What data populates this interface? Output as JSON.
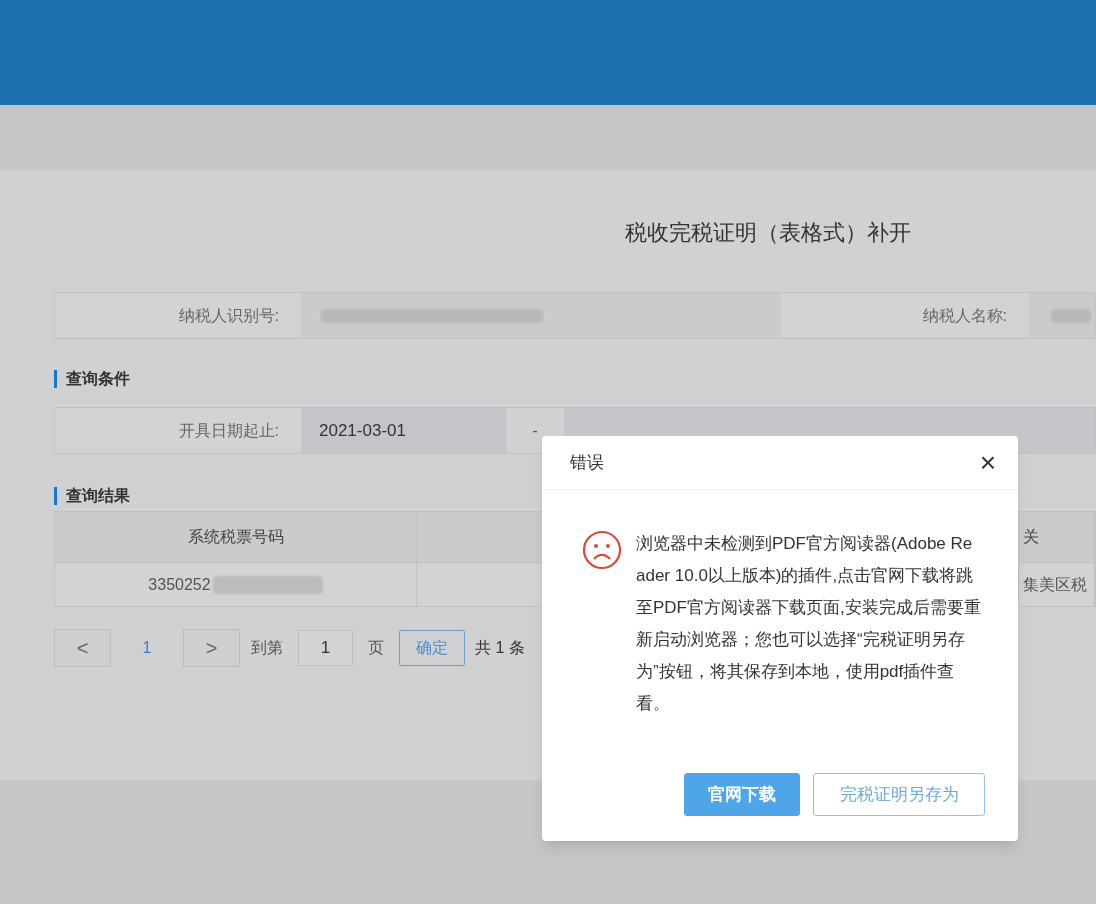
{
  "page_title": "税收完税证明（表格式）补开",
  "taxpayer_fields": [
    {
      "label": "纳税人识别号:"
    },
    {
      "label": "纳税人名称:"
    }
  ],
  "query_section": {
    "heading": "查询条件",
    "date_label": "开具日期起止:",
    "date_from": "2021-03-01",
    "separator": "-"
  },
  "result_section": {
    "heading": "查询结果",
    "table": {
      "columns": [
        "系统税票号码",
        "",
        "关"
      ],
      "rows": [
        [
          "3350252",
          "",
          "集美区税"
        ]
      ]
    }
  },
  "pagination": {
    "prev": "<",
    "pages": [
      {
        "label": "1",
        "selected": true
      }
    ],
    "next": ">",
    "goto_label": "到第",
    "goto_value": "1",
    "page_unit": "页",
    "confirm": "确定",
    "total": "共 1 条"
  },
  "dialog": {
    "title": "错误",
    "close": "×",
    "message": "浏览器中未检测到PDF官方阅读器(Adobe Reader 10.0以上版本)的插件,点击官网下载将跳至PDF官方阅读器下载页面,安装完成后需要重新启动浏览器；您也可以选择“完税证明另存为”按钮，将其保存到本地，使用pdf插件查看。",
    "buttons": [
      {
        "label": "官网下载",
        "kind": "primary"
      },
      {
        "label": "完税证明另存为",
        "kind": "outline"
      }
    ]
  }
}
